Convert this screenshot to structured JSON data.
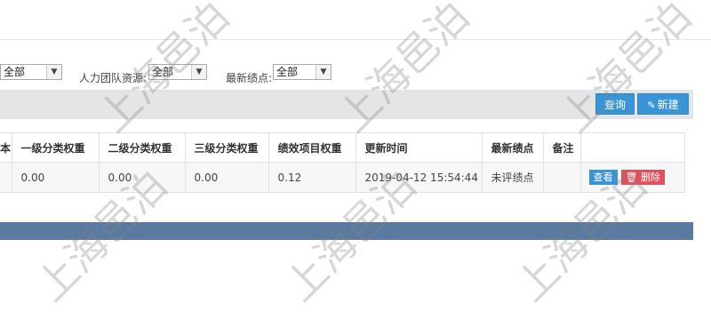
{
  "filters": {
    "f1": {
      "value": "全部"
    },
    "f2": {
      "label": "人力团队资源:",
      "value": "全部"
    },
    "f3": {
      "label": "最新绩点:",
      "value": "全部"
    }
  },
  "toolbar": {
    "query_label": "查询",
    "new_label": "新建"
  },
  "table": {
    "headers": [
      "本",
      "一级分类权重",
      "二级分类权重",
      "三级分类权重",
      "绩效项目权重",
      "更新时间",
      "最新绩点",
      "备注",
      ""
    ],
    "rows": [
      {
        "c1": "0.00",
        "c2": "0.00",
        "c3": "0.00",
        "c4": "0.12",
        "c5": "2019-04-12 15:54:44",
        "c6": "未评绩点",
        "c7": "",
        "view": "查看",
        "del": "删除"
      }
    ]
  },
  "watermark": "上海邑泊"
}
